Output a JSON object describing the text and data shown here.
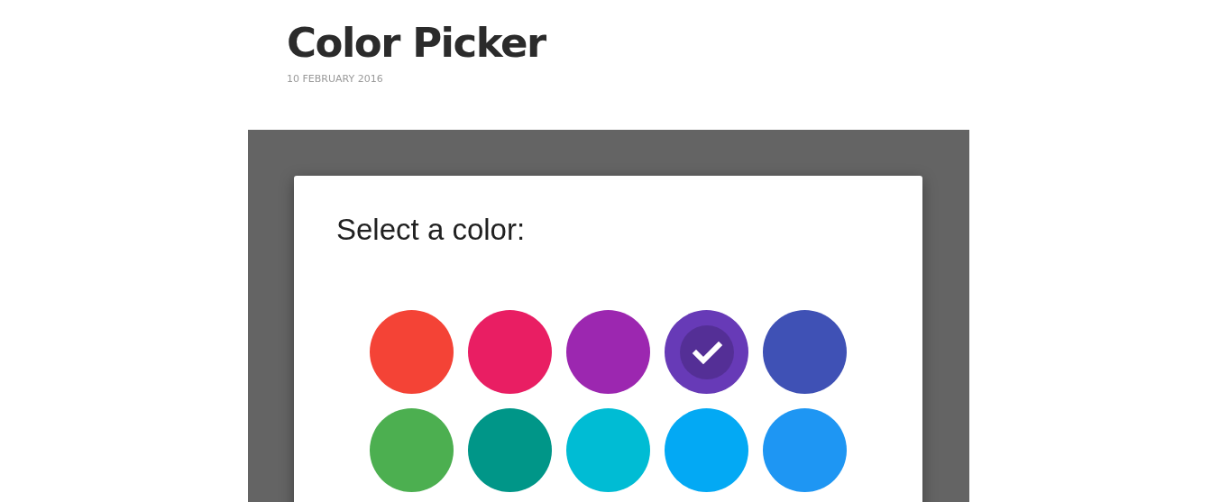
{
  "post": {
    "title": "Color Picker",
    "date": "10 FEBRUARY 2016"
  },
  "dialog": {
    "heading": "Select a color:",
    "swatches": [
      {
        "color": "#f44336",
        "selected": false
      },
      {
        "color": "#e91e63",
        "selected": false
      },
      {
        "color": "#9c27b0",
        "selected": false
      },
      {
        "color": "#673ab7",
        "selected": true
      },
      {
        "color": "#3f51b5",
        "selected": false
      },
      {
        "color": "#4caf50",
        "selected": false
      },
      {
        "color": "#009688",
        "selected": false
      },
      {
        "color": "#00bcd4",
        "selected": false
      },
      {
        "color": "#03a9f4",
        "selected": false
      },
      {
        "color": "#1e96f3",
        "selected": false
      }
    ]
  }
}
